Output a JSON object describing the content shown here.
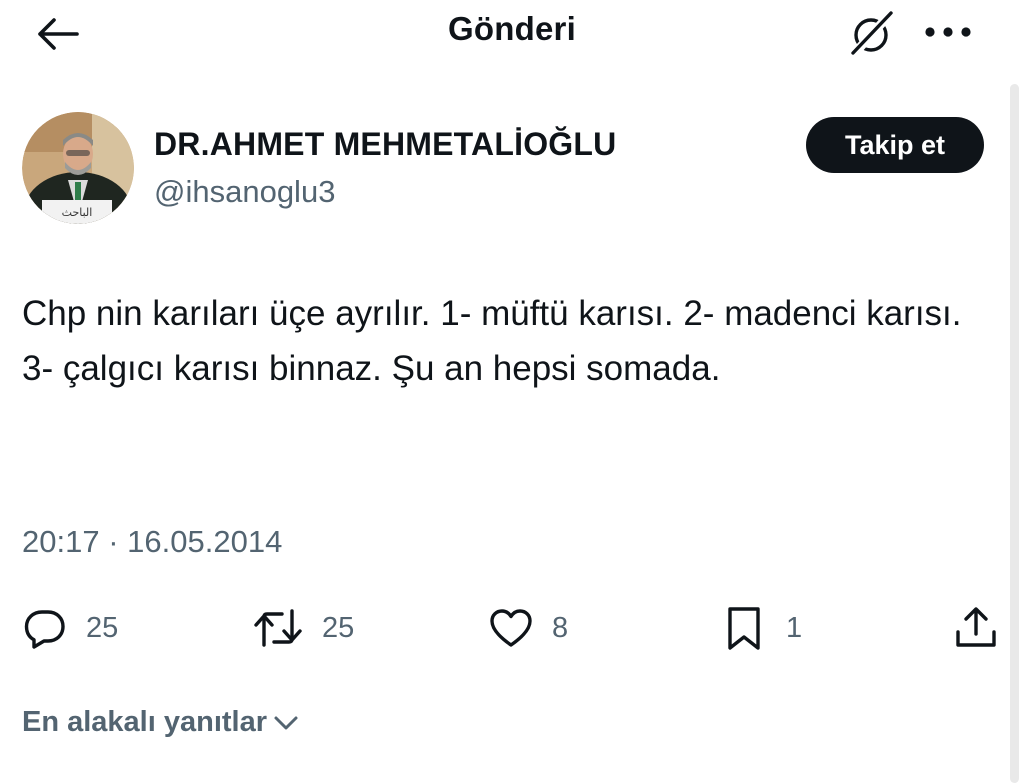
{
  "header": {
    "title": "Gönderi",
    "back_icon": "arrow-left-icon",
    "grok_icon": "grok-icon",
    "more_icon": "more-horizontal-icon"
  },
  "author": {
    "name": "DR.AHMET MEHMETALİOĞLU",
    "handle": "@ihsanoglu3",
    "follow_label": "Takip et",
    "avatar_plate_text": "الباحث"
  },
  "post": {
    "text": "Chp nin karıları üçe ayrılır. 1- müftü karısı. 2- madenci karısı. 3- çalgıcı karısı binnaz. Şu an hepsi somada.",
    "time": "20:17",
    "separator": "·",
    "date": "16.05.2014"
  },
  "actions": {
    "reply": {
      "icon": "reply-icon",
      "count": "25"
    },
    "repost": {
      "icon": "repost-icon",
      "count": "25"
    },
    "like": {
      "icon": "heart-icon",
      "count": "8"
    },
    "bookmark": {
      "icon": "bookmark-icon",
      "count": "1"
    },
    "share": {
      "icon": "share-icon"
    }
  },
  "replies": {
    "sort_label": "En alakalı yanıtlar",
    "sort_icon": "chevron-down-icon"
  },
  "colors": {
    "text_primary": "#0f1419",
    "text_secondary": "#536471",
    "follow_button_bg": "#0f1419",
    "follow_button_text": "#ffffff",
    "background": "#ffffff"
  }
}
